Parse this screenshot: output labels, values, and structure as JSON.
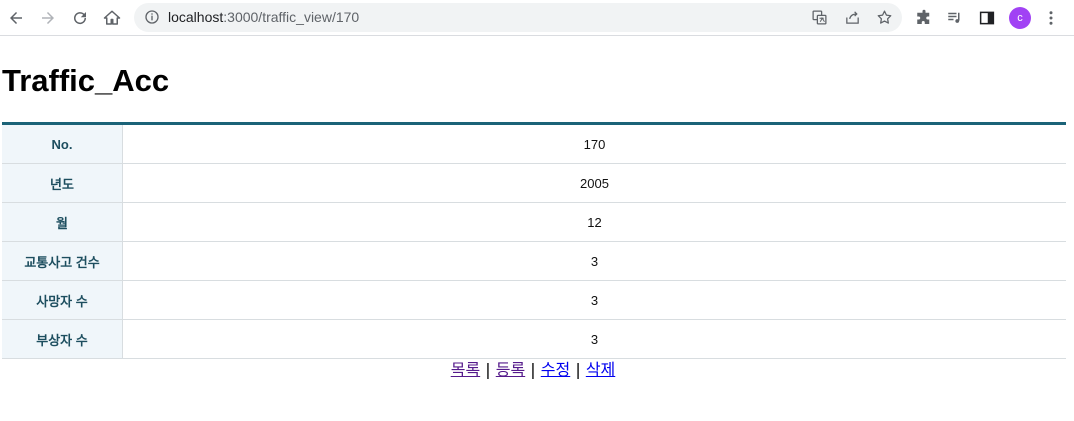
{
  "browser": {
    "url_host": "localhost",
    "url_path": ":3000/traffic_view/170",
    "avatar_letter": "c",
    "avatar_color": "#a142f4"
  },
  "page": {
    "title": "Traffic_Acc",
    "rows": [
      {
        "label": "No.",
        "value": "170"
      },
      {
        "label": "년도",
        "value": "2005"
      },
      {
        "label": "월",
        "value": "12"
      },
      {
        "label": "교통사고 건수",
        "value": "3"
      },
      {
        "label": "사망자 수",
        "value": "3"
      },
      {
        "label": "부상자 수",
        "value": "3"
      }
    ],
    "links": {
      "list": "목록",
      "register": "등록",
      "edit": "수정",
      "delete": "삭제",
      "separator": "|"
    }
  },
  "colors": {
    "table_border_accent": "#1b6378",
    "header_cell_bg": "#f0f6fa",
    "header_cell_text": "#1d4e5f"
  }
}
